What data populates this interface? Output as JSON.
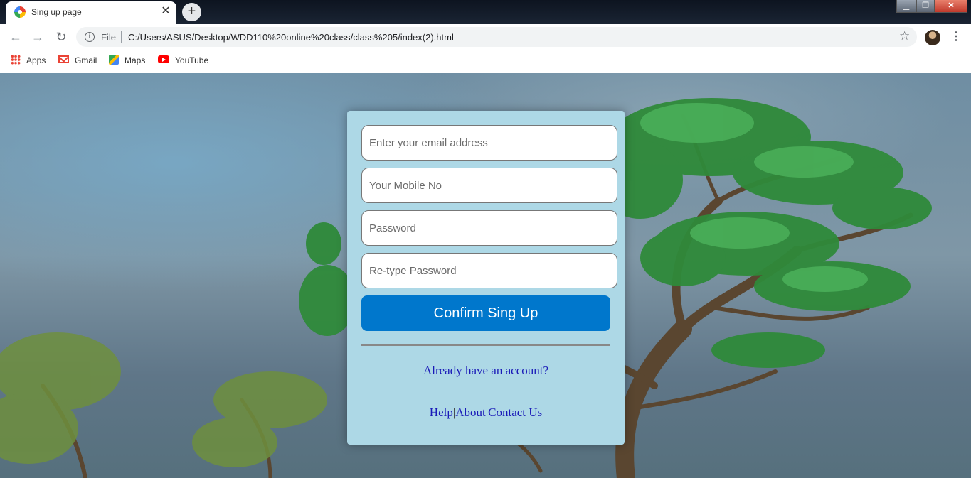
{
  "browser": {
    "tab_title": "Sing up page",
    "new_tab_label": "+",
    "close_tab_label": "✕",
    "file_label": "File",
    "url": "C:/Users/ASUS/Desktop/WDD110%20online%20class/class%205/index(2).html",
    "bookmarks": [
      {
        "label": "Apps",
        "icon": "apps-grid-icon"
      },
      {
        "label": "Gmail",
        "icon": "gmail-icon"
      },
      {
        "label": "Maps",
        "icon": "maps-icon"
      },
      {
        "label": "YouTube",
        "icon": "youtube-icon"
      }
    ]
  },
  "form": {
    "email_placeholder": "Enter your email address",
    "mobile_placeholder": "Your Mobile No",
    "password_placeholder": "Password",
    "retype_placeholder": "Re-type Password",
    "confirm_label": "Confirm Sing Up",
    "already_label": "Already have an account?",
    "footer": {
      "help": "Help",
      "about": "About",
      "contact": "Contact Us",
      "separator": "|"
    }
  },
  "colors": {
    "card_bg": "#add8e6",
    "button_bg": "#0077cc",
    "link": "#1a1ab8"
  }
}
